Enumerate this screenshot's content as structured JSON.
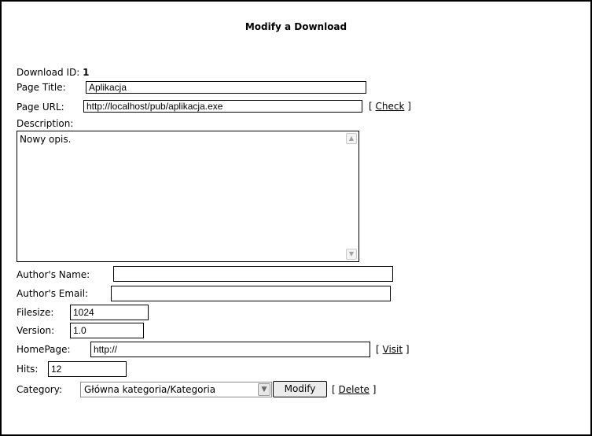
{
  "title": "Modify a Download",
  "fields": {
    "download_id_label": "Download ID:",
    "download_id_value": "1",
    "page_title_label": "Page Title:",
    "page_title_value": "Aplikacja",
    "page_url_label": "Page URL:",
    "page_url_value": "http://localhost/pub/aplikacja.exe",
    "description_label": "Description:",
    "description_value": "Nowy opis.",
    "author_name_label": "Author's Name:",
    "author_name_value": "",
    "author_email_label": "Author's Email:",
    "author_email_value": "",
    "filesize_label": "Filesize:",
    "filesize_value": "1024",
    "version_label": "Version:",
    "version_value": "1.0",
    "homepage_label": "HomePage:",
    "homepage_value": "http://",
    "hits_label": "Hits:",
    "hits_value": "12",
    "category_label": "Category:",
    "category_value": "Główna kategoria/Kategoria"
  },
  "links": {
    "check": "Check",
    "visit": "Visit",
    "delete": "Delete",
    "bracket_open": "[",
    "bracket_close": "]"
  },
  "buttons": {
    "modify": "Modify"
  },
  "icons": {
    "scroll_up": "chevron-up-icon",
    "scroll_down": "chevron-down-icon",
    "select_arrow": "chevron-down-icon"
  }
}
